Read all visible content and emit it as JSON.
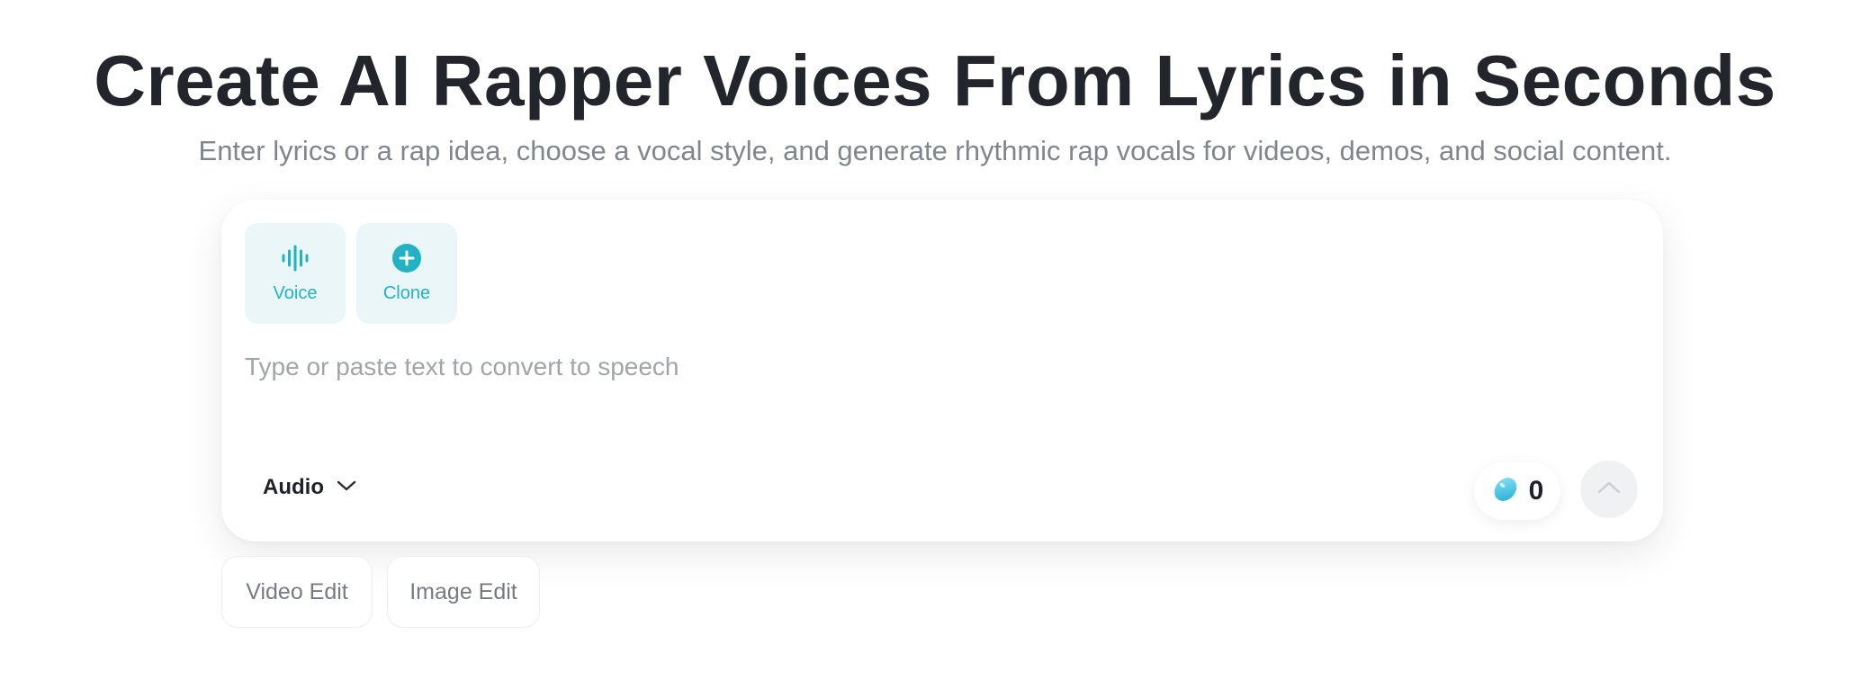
{
  "hero": {
    "title": "Create AI Rapper Voices From Lyrics in Seconds",
    "subtitle": "Enter lyrics or a rap idea, choose a vocal style, and generate rhythmic rap vocals for videos, demos, and social content."
  },
  "composer": {
    "modes": [
      {
        "label": "Voice",
        "icon": "waveform-icon"
      },
      {
        "label": "Clone",
        "icon": "plus-circle-icon"
      }
    ],
    "input": {
      "placeholder": "Type or paste text to convert to speech",
      "value": ""
    },
    "output_type": {
      "label": "Audio",
      "icon": "chevron-down-icon"
    },
    "credits": {
      "count": "0",
      "icon": "bean-icon"
    },
    "send": {
      "icon": "arrow-up-icon"
    }
  },
  "quick_actions": [
    {
      "label": "Video Edit"
    },
    {
      "label": "Image Edit"
    }
  ],
  "colors": {
    "accent": "#22b2c6",
    "mode_bg": "#ebf6f9",
    "title": "#22252b",
    "subtitle": "#80868e",
    "placeholder": "#a0a5ab"
  }
}
